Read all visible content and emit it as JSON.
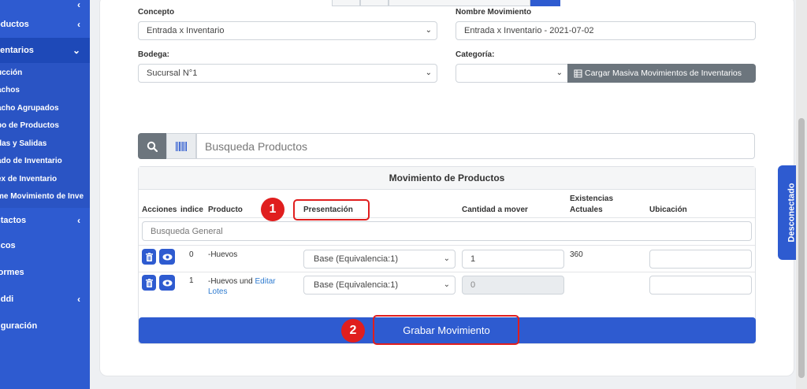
{
  "sidebar": {
    "main_items": [
      {
        "label": "oductos",
        "chevron": "‹"
      },
      {
        "label": "ventarios",
        "chevron": "⌄"
      },
      {
        "label": "ntactos",
        "chevron": "‹"
      },
      {
        "label": "ncos",
        "chevron": ""
      },
      {
        "label": "formes",
        "chevron": ""
      },
      {
        "label": "nddi",
        "chevron": "‹"
      },
      {
        "label": "figuración",
        "chevron": ""
      }
    ],
    "sub_items": [
      "ucción",
      "achos",
      "acho Agrupados",
      "po de Productos",
      "das y Salidas",
      "ado de Inventario",
      "ex de Inventario",
      "me Movimiento de Inve"
    ]
  },
  "form": {
    "concepto_label": "Concepto",
    "concepto_value": "Entrada x Inventario",
    "nombre_label": "Nombre Movimiento",
    "nombre_value": "Entrada x Inventario - 2021-07-02",
    "bodega_label": "Bodega:",
    "bodega_value": "Sucursal N°1",
    "categoria_label": "Categoría:",
    "categoria_value": "",
    "cargar_button": "Cargar Masiva Movimientos de Inventarios"
  },
  "search": {
    "placeholder": "Busqueda Productos"
  },
  "table": {
    "title": "Movimiento de Productos",
    "headers": {
      "acciones": "Acciones",
      "indice": "indice",
      "producto": "Producto",
      "presentacion": "Presentación",
      "cantidad": "Cantidad a mover",
      "existencias_1": "Existencias",
      "existencias_2": "Actuales",
      "ubicacion": "Ubicación"
    },
    "general_search": "Busqueda General",
    "rows": [
      {
        "indice": "0",
        "producto": "-Huevos",
        "producto_link": "",
        "producto_link2": "",
        "presentacion": "Base (Equivalencia:1)",
        "cantidad": "1",
        "existencias": "360"
      },
      {
        "indice": "1",
        "producto": "-Huevos und",
        "producto_link": "Editar",
        "producto_link2": "Lotes",
        "presentacion": "Base (Equivalencia:1)",
        "cantidad": "0",
        "existencias": ""
      }
    ]
  },
  "submit_button": "Grabar Movimiento",
  "annotations": {
    "step1": "1",
    "step2": "2"
  },
  "status_tab": "Desconectado",
  "colors": {
    "primary": "#2e5bd0",
    "annotation": "#e01e1e",
    "secondary": "#6c757d"
  }
}
